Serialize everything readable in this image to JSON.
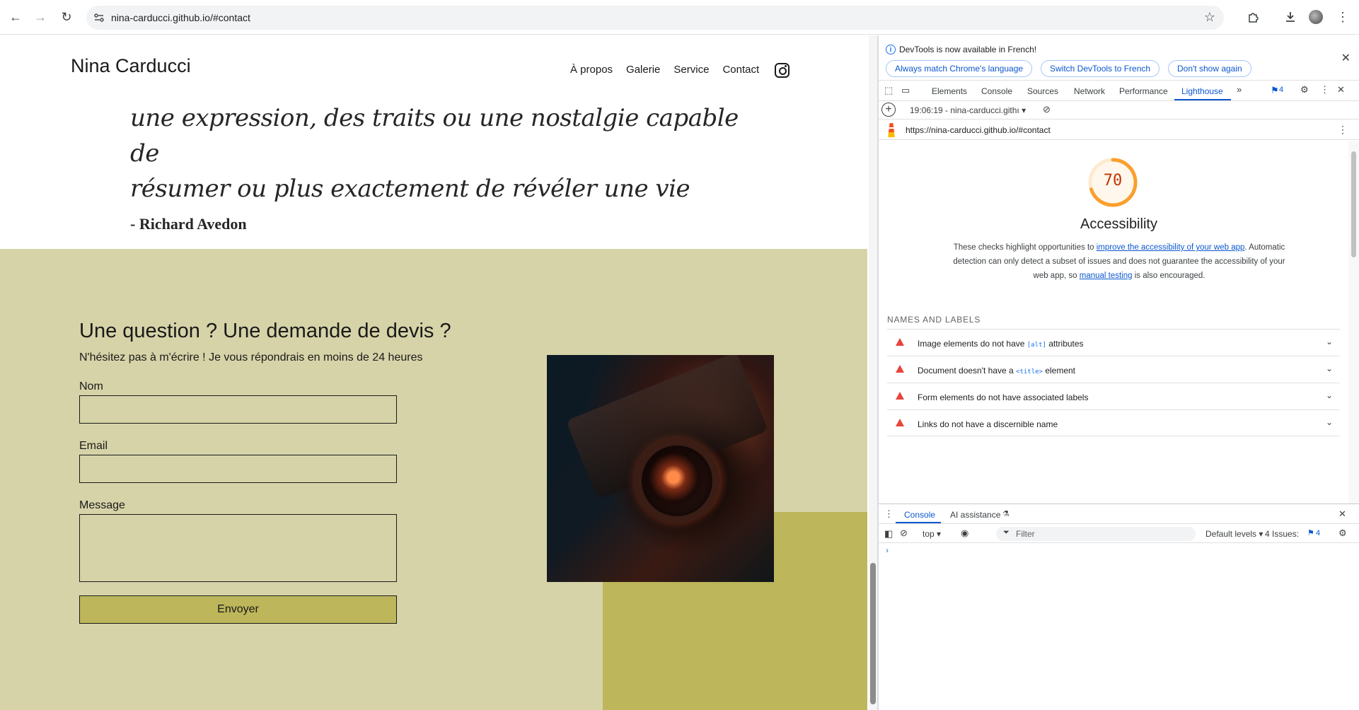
{
  "browser": {
    "url": "nina-carducci.github.io/#contact",
    "icons": [
      "back-icon",
      "forward-icon",
      "reload-icon",
      "site-info-icon",
      "bookmark-star-icon",
      "extensions-icon",
      "download-icon",
      "profile-avatar",
      "menu-icon"
    ]
  },
  "site": {
    "brand": "Nina Carducci",
    "nav": [
      "À propos",
      "Galerie",
      "Service",
      "Contact"
    ],
    "quote_line1": "une expression, des traits ou une nostalgie capable de",
    "quote_line2": "résumer ou plus exactement de révéler une vie",
    "quote_author": "- Richard Avedon",
    "contact": {
      "title": "Une question ? Une demande de devis ?",
      "subtitle": "N'hésitez pas à m'écrire ! Je vous répondrais en moins de 24 heures",
      "name_label": "Nom",
      "email_label": "Email",
      "message_label": "Message",
      "submit": "Envoyer"
    },
    "colors": {
      "contact_bg": "#d6d3a8",
      "accent": "#bdb65a"
    }
  },
  "devtools": {
    "banner": {
      "message": "DevTools is now available in French!",
      "btn_match": "Always match Chrome's language",
      "btn_switch": "Switch DevTools to French",
      "btn_dismiss": "Don't show again"
    },
    "tabs": [
      "Elements",
      "Console",
      "Sources",
      "Network",
      "Performance",
      "Lighthouse"
    ],
    "active_tab": "Lighthouse",
    "issues_badge": "4",
    "lighthouse": {
      "report": "19:06:19 - nina-carducci.githı ▾",
      "url": "https://nina-carducci.github.io/#contact",
      "score": "70",
      "score_fraction": 0.7,
      "score_color": "#fa9f2e",
      "category": "Accessibility",
      "desc_part1": "These checks highlight opportunities to ",
      "desc_link1": "improve the accessibility of your web app",
      "desc_part2": ". Automatic detection can only detect a subset of issues and does not guarantee the accessibility of your web app, so ",
      "desc_link2": "manual testing",
      "desc_part3": " is also encouraged.",
      "group": "NAMES AND LABELS",
      "audits": [
        {
          "pre": "Image elements do not have ",
          "code": "[alt]",
          "post": " attributes"
        },
        {
          "pre": "Document doesn't have a ",
          "code": "<title>",
          "post": " element"
        },
        {
          "pre": "Form elements do not have associated labels",
          "code": "",
          "post": ""
        },
        {
          "pre": "Links do not have a discernible name",
          "code": "",
          "post": ""
        }
      ]
    },
    "drawer": {
      "tabs": [
        "Console",
        "AI assistance"
      ],
      "context": "top ▾",
      "filter_placeholder": "Filter",
      "levels": "Default levels ▾",
      "issues": "4 Issues:",
      "issues_count": "4",
      "prompt": "›"
    }
  }
}
